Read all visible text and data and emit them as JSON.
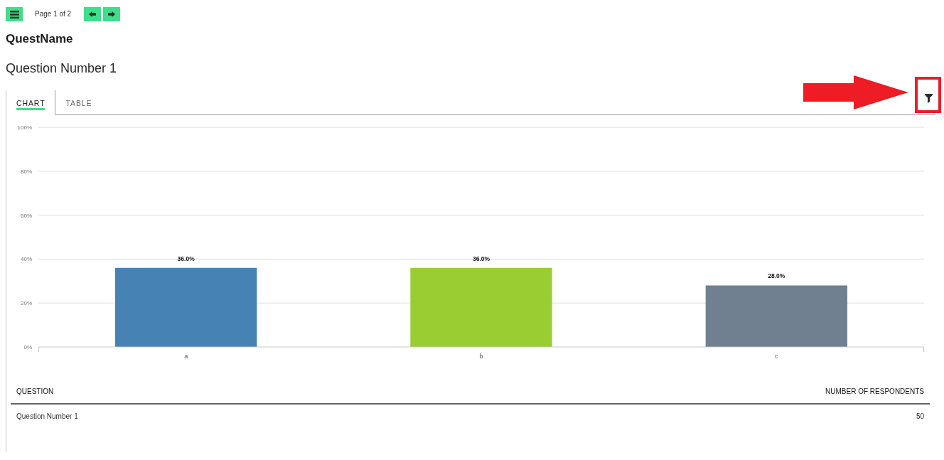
{
  "toolbar": {
    "page_label": "Page 1 of 2"
  },
  "title": "QuestName",
  "question_title": "Question Number 1",
  "tabs": [
    {
      "label": "CHART",
      "selected": true
    },
    {
      "label": "TABLE",
      "selected": false
    }
  ],
  "chart": {
    "bars": [
      {
        "color": "#4682b4"
      },
      {
        "color": "#9acd32"
      },
      {
        "color": "#708090"
      }
    ],
    "chart_data": {
      "type": "bar",
      "categories": [
        "a",
        "b",
        "c"
      ],
      "values": [
        36,
        36,
        28
      ],
      "ylim": [
        0,
        100
      ],
      "yticks": [
        {
          "value": 0,
          "label": "0%"
        },
        {
          "value": 20,
          "label": "20%"
        },
        {
          "value": 40,
          "label": "40%"
        },
        {
          "value": 60,
          "label": "60%"
        },
        {
          "value": 80,
          "label": "80%"
        },
        {
          "value": 100,
          "label": "100%"
        }
      ],
      "grid": true,
      "value_labels": [
        "36.0%",
        "36.0%",
        "28.0%"
      ]
    }
  },
  "table": {
    "columns": [
      "QUESTION",
      "NUMBER OF RESPONDENTS"
    ],
    "rows": [
      [
        "Question Number 1",
        "50"
      ]
    ]
  }
}
